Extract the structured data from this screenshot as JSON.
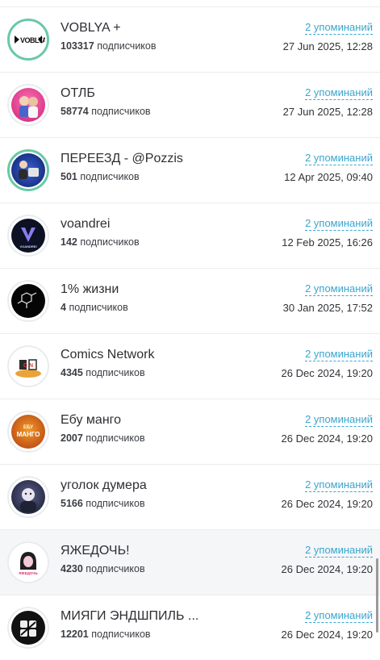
{
  "items": [
    {
      "name": "VOBLYA +",
      "subs_count": "103317",
      "subs_label": "подписчиков",
      "mentions": "2 упоминаний",
      "date": "27 Jun 2025, 12:28",
      "avatar_icon": "voblya-logo-icon",
      "avatar_text": "VOBLYA"
    },
    {
      "name": "ОТЛБ",
      "subs_count": "58774",
      "subs_label": "подписчиков",
      "mentions": "2 упоминаний",
      "date": "27 Jun 2025, 12:28",
      "avatar_icon": "cartoon-duo-avatar-icon",
      "avatar_text": ""
    },
    {
      "name": "ПЕРЕЕЗД - @Pozzis",
      "subs_count": "501",
      "subs_label": "подписчиков",
      "mentions": "2 упоминаний",
      "date": "12 Apr 2025, 09:40",
      "avatar_icon": "suitcase-avatar-icon",
      "avatar_text": ""
    },
    {
      "name": "voandrei",
      "subs_count": "142",
      "subs_label": "подписчиков",
      "mentions": "2 упоминаний",
      "date": "12 Feb 2025, 16:26",
      "avatar_icon": "v-logo-icon",
      "avatar_text": "VOANDREI"
    },
    {
      "name": "1% жизни",
      "subs_count": "4",
      "subs_label": "подписчиков",
      "mentions": "2 упоминаний",
      "date": "30 Jan 2025, 17:52",
      "avatar_icon": "molecule-avatar-icon",
      "avatar_text": ""
    },
    {
      "name": "Comics Network",
      "subs_count": "4345",
      "subs_label": "подписчиков",
      "mentions": "2 упоминаний",
      "date": "26 Dec 2024, 19:20",
      "avatar_icon": "cn-logo-icon",
      "avatar_text": "C N"
    },
    {
      "name": "Ебу манго",
      "subs_count": "2007",
      "subs_label": "подписчиков",
      "mentions": "2 упоминаний",
      "date": "26 Dec 2024, 19:20",
      "avatar_icon": "mango-logo-icon",
      "avatar_text": "МАНГО"
    },
    {
      "name": "уголок думера",
      "subs_count": "5166",
      "subs_label": "подписчиков",
      "mentions": "2 упоминаний",
      "date": "26 Dec 2024, 19:20",
      "avatar_icon": "doomer-avatar-icon",
      "avatar_text": ""
    },
    {
      "name": "ЯЖЕДОЧЬ!",
      "subs_count": "4230",
      "subs_label": "подписчиков",
      "mentions": "2 упоминаний",
      "date": "26 Dec 2024, 19:20",
      "avatar_icon": "girl-avatar-icon",
      "avatar_text": "ЯЖЕДОЧЬ"
    },
    {
      "name": "МИЯГИ ЭНДШПИЛЬ ...",
      "subs_count": "12201",
      "subs_label": "подписчиков",
      "mentions": "2 упоминаний",
      "date": "26 Dec 2024, 19:20",
      "avatar_icon": "band-logo-icon",
      "avatar_text": ""
    }
  ],
  "colors": {
    "accent_link": "#3aa6cf",
    "ring": "#69c9a6",
    "highlight_row": "#f5f6f8"
  }
}
